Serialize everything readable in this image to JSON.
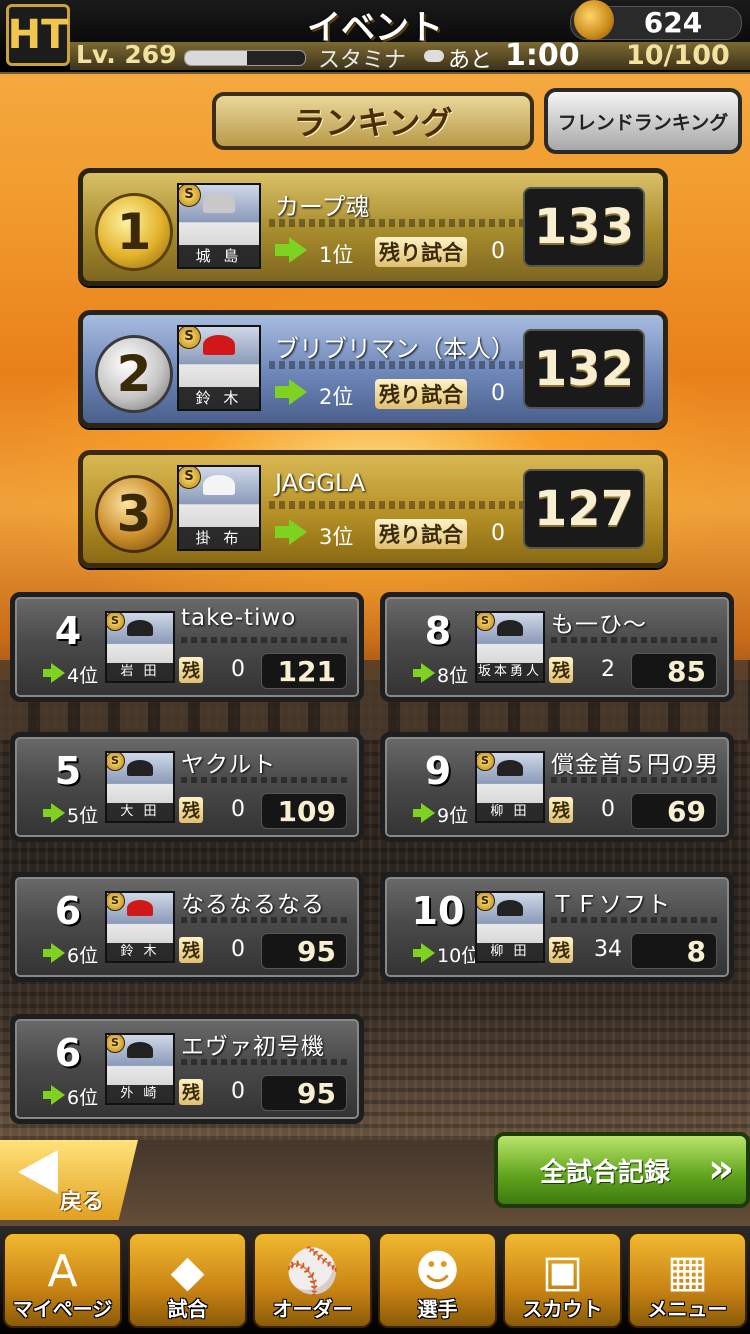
{
  "header": {
    "logo_text": "HT",
    "title": "イベント",
    "coins": "624",
    "level": "Lv. 269",
    "exp_fraction": 0.52,
    "stamina_label": "スタミナ",
    "ato_label": "あと",
    "timer": "1:00",
    "stamina": "10/100"
  },
  "tabs": {
    "ranking": "ランキング",
    "friend_ranking": "フレンドランキング"
  },
  "labels": {
    "remaining_long": "残り試合",
    "remaining_short": "残"
  },
  "top3": [
    {
      "rank": "1",
      "player": "城 島",
      "name": "カープ魂",
      "position": "1位",
      "remaining": "0",
      "score": "133",
      "style": "g",
      "cap": "#c8c8c8"
    },
    {
      "rank": "2",
      "player": "鈴 木",
      "name": "ブリブリマン（本人）",
      "position": "2位",
      "remaining": "0",
      "score": "132",
      "style": "s",
      "cap": "#d01818"
    },
    {
      "rank": "3",
      "player": "掛 布",
      "name": "JAGGLA",
      "position": "3位",
      "remaining": "0",
      "score": "127",
      "style": "b",
      "cap": "#f4f4f4"
    }
  ],
  "left_list": [
    {
      "rank": "4",
      "player": "岩 田",
      "name": "take-tiwo",
      "position": "4位",
      "remaining": "0",
      "score": "121",
      "cap": "#222"
    },
    {
      "rank": "5",
      "player": "大 田",
      "name": "ヤクルト",
      "position": "5位",
      "remaining": "0",
      "score": "109",
      "cap": "#222"
    },
    {
      "rank": "6",
      "player": "鈴 木",
      "name": "なるなるなる",
      "position": "6位",
      "remaining": "0",
      "score": "95",
      "cap": "#d01818"
    },
    {
      "rank": "6",
      "player": "外 崎",
      "name": "エヴァ初号機",
      "position": "6位",
      "remaining": "0",
      "score": "95",
      "cap": "#222"
    }
  ],
  "right_list": [
    {
      "rank": "8",
      "player": "坂本勇人",
      "name": "も一ひ～",
      "position": "8位",
      "remaining": "2",
      "score": "85",
      "cap": "#222"
    },
    {
      "rank": "9",
      "player": "柳 田",
      "name": "償金首５円の男",
      "position": "9位",
      "remaining": "0",
      "score": "69",
      "cap": "#222"
    },
    {
      "rank": "10",
      "player": "柳 田",
      "name": "ＴＦソフト",
      "position": "10位",
      "remaining": "34",
      "score": "8",
      "cap": "#222"
    }
  ],
  "buttons": {
    "back": "戻る",
    "all_records": "全試合記録",
    "chevrons": "»"
  },
  "nav": [
    {
      "label": "マイページ",
      "icon": "A"
    },
    {
      "label": "試合",
      "icon": "◆"
    },
    {
      "label": "オーダー",
      "icon": "⚾"
    },
    {
      "label": "選手",
      "icon": "☻"
    },
    {
      "label": "スカウト",
      "icon": "▣"
    },
    {
      "label": "メニュー",
      "icon": "▦"
    }
  ]
}
